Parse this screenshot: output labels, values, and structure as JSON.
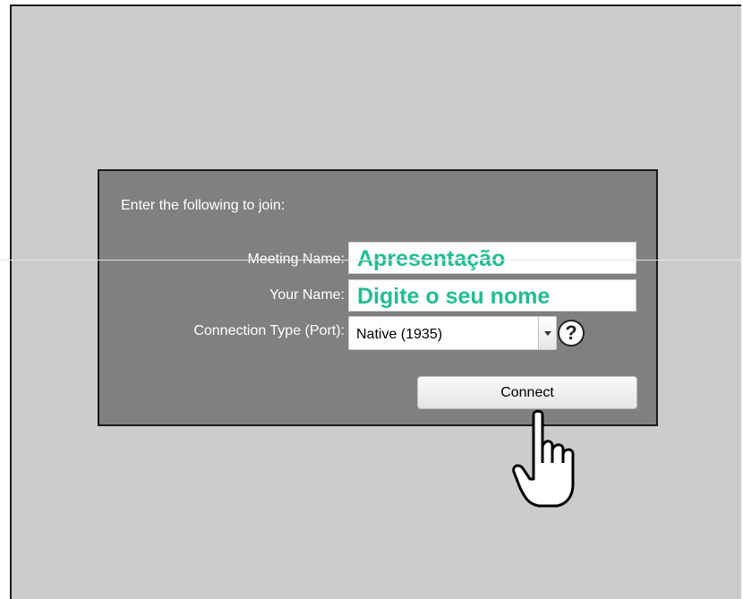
{
  "dialog": {
    "heading": "Enter the following to join:",
    "meeting_name": {
      "label": "Meeting Name:",
      "value": "Apresentação"
    },
    "your_name": {
      "label": "Your Name:",
      "value": "Digite o seu nome"
    },
    "connection_type": {
      "label": "Connection Type (Port):",
      "selected": "Native (1935)"
    },
    "help_label": "?",
    "connect_label": "Connect"
  },
  "colors": {
    "background": "#cccccc",
    "dialog": "#808080",
    "field_text": "#1fbf8f"
  },
  "icons": {
    "help": "question-icon",
    "dropdown": "chevron-down-icon",
    "pointer": "hand-pointer-icon"
  }
}
